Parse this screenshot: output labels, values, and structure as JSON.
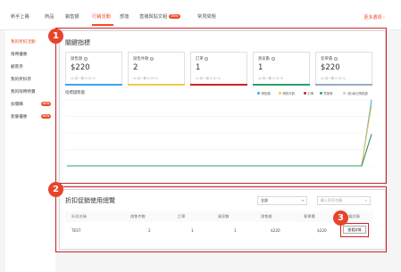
{
  "nav": {
    "items": [
      "新手上路",
      "商品",
      "銷售額",
      "行銷活動",
      "部落",
      "直播與貼文組",
      "常見問題"
    ],
    "live_badge": "NEW",
    "more_link": "更多選項 ›"
  },
  "sidebar": {
    "items": [
      "我的折扣活動",
      "限時優惠",
      "顧客券",
      "我的折扣券",
      "我的限時特賣",
      "加價購",
      "套餐優惠"
    ],
    "badges": [
      "NEW",
      "NEW"
    ]
  },
  "key_metrics": {
    "title": "關鍵指標",
    "cards": [
      {
        "label": "銷售額",
        "value": "$220",
        "sub": "vs 前一期 0.00 %",
        "color": "#3da5f4"
      },
      {
        "label": "銷售件數",
        "value": "2",
        "sub": "vs 前一期 0.00 %",
        "color": "#f2c94c"
      },
      {
        "label": "訂單",
        "value": "1",
        "sub": "vs 前一期 0.00 %",
        "color": "#d0202a"
      },
      {
        "label": "買家數",
        "value": "1",
        "sub": "vs 前一期 0.00 %",
        "color": "#2f9e6e"
      },
      {
        "label": "客單價",
        "value": "$220",
        "sub": "vs 前一期 0.00 %",
        "color": "#9aa9c7"
      }
    ],
    "chart_title": "指標趨勢圖",
    "legend": [
      "銷售額",
      "銷售件數",
      "訂單",
      "買家數",
      "(前)每日銷售額"
    ],
    "legend_colors": [
      "#3da5f4",
      "#f2c94c",
      "#d0202a",
      "#2f9e6e",
      "#cccccc"
    ]
  },
  "chart_data": {
    "type": "line",
    "title": "指標趨勢圖",
    "xlabel": "",
    "ylabel": "",
    "series": [
      {
        "name": "銷售額",
        "values": [
          0,
          0,
          0,
          0,
          0,
          0,
          0,
          0,
          0,
          0,
          0,
          0,
          0,
          0,
          0,
          0,
          0,
          0,
          0,
          0,
          0,
          0,
          0,
          0,
          0,
          0,
          0,
          0,
          0,
          0,
          0,
          100
        ]
      },
      {
        "name": "銷售件數",
        "values": [
          0,
          0,
          0,
          0,
          0,
          0,
          0,
          0,
          0,
          0,
          0,
          0,
          0,
          0,
          0,
          0,
          0,
          0,
          0,
          0,
          0,
          0,
          0,
          0,
          0,
          0,
          0,
          0,
          0,
          0,
          0,
          92
        ]
      },
      {
        "name": "訂單",
        "values": [
          0,
          0,
          0,
          0,
          0,
          0,
          0,
          0,
          0,
          0,
          0,
          0,
          0,
          0,
          0,
          0,
          0,
          0,
          0,
          0,
          0,
          0,
          0,
          0,
          0,
          0,
          0,
          0,
          0,
          0,
          0,
          48
        ]
      },
      {
        "name": "買家數",
        "values": [
          0,
          0,
          0,
          0,
          0,
          0,
          0,
          0,
          0,
          0,
          0,
          0,
          0,
          0,
          0,
          0,
          0,
          0,
          0,
          0,
          0,
          0,
          0,
          0,
          0,
          0,
          0,
          0,
          0,
          0,
          0,
          48
        ]
      }
    ],
    "ylim": [
      0,
      100
    ],
    "grid": true
  },
  "discount_table": {
    "title": "折扣促銷使用總覽",
    "filter_value": "全部",
    "search_placeholder": "輸入折扣名稱",
    "headers": [
      "折扣名稱",
      "銷售件數",
      "訂單",
      "買家數",
      "銷售額",
      "客單價",
      "查看詳情"
    ],
    "rows": [
      {
        "name": "TEST",
        "units": "2",
        "orders": "1",
        "buyers": "1",
        "sales": "$220",
        "aov": "$220",
        "action": "查看詳情"
      }
    ]
  },
  "markers": [
    "1",
    "2",
    "3"
  ]
}
